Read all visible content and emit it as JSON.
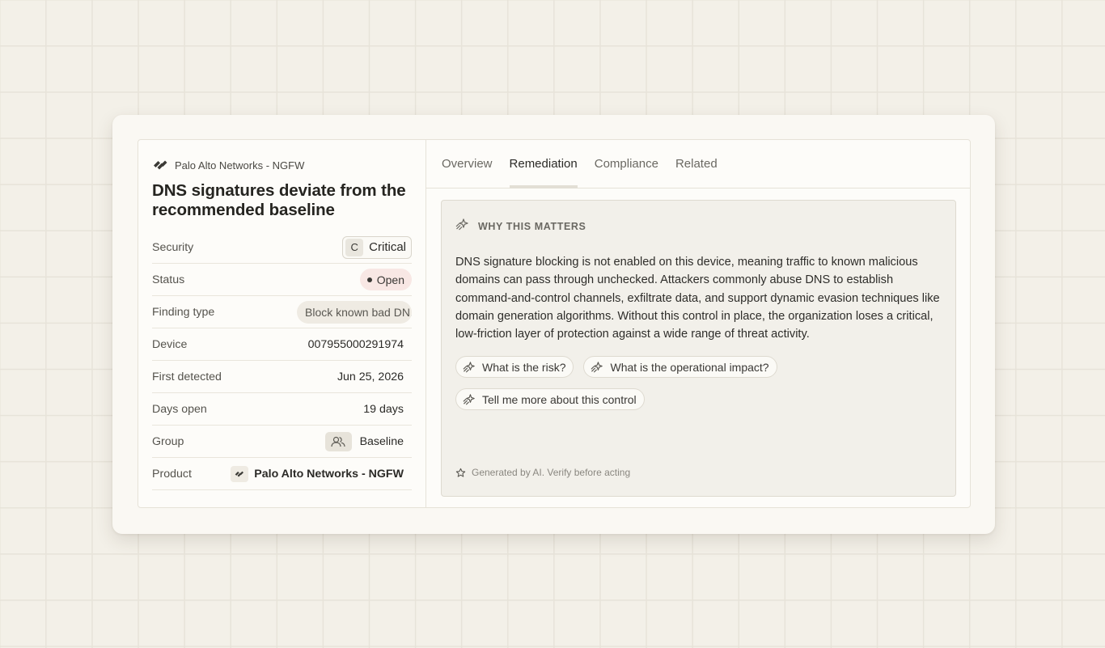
{
  "finding": {
    "vendor": "Palo Alto Networks - NGFW",
    "title": "DNS signatures deviate from the recommended baseline"
  },
  "properties": {
    "security_label": "Security",
    "security_letter": "C",
    "security_value": "Critical",
    "status_label": "Status",
    "status_value": "Open",
    "finding_type_label": "Finding type",
    "finding_type_value": "Block known bad DN...",
    "device_label": "Device",
    "device_value": "007955000291974",
    "first_detected_label": "First detected",
    "first_detected_value": "Jun 25, 2026",
    "days_open_label": "Days open",
    "days_open_value": "19 days",
    "group_label": "Group",
    "group_value": "Baseline",
    "product_label": "Product",
    "product_value": "Palo Alto Networks - NGFW"
  },
  "tabs": [
    {
      "label": "Overview",
      "active": false
    },
    {
      "label": "Remediation",
      "active": true
    },
    {
      "label": "Compliance",
      "active": false
    },
    {
      "label": "Related",
      "active": false
    }
  ],
  "why": {
    "title": "WHY THIS MATTERS",
    "body": "DNS signature blocking is not enabled on this device, meaning traffic to known malicious domains can pass through unchecked. Attackers commonly abuse DNS to establish command-and-control channels, exfiltrate data, and support dynamic evasion techniques like domain generation algorithms. Without this control in place, the organization loses a critical, low-friction layer of protection against a wide range of threat activity.",
    "prompts": [
      "What is the risk?",
      "What is the operational impact?",
      "Tell me more about this control"
    ],
    "note": "Generated by AI. Verify before acting"
  },
  "icons": {
    "vendor": "palo-alto-logo-icon",
    "sparkle": "sparkle-icon",
    "star": "star-icon",
    "group": "users-icon"
  },
  "colors": {
    "background": "#f3f0e8",
    "status_open_bg": "#f8e7e4"
  }
}
